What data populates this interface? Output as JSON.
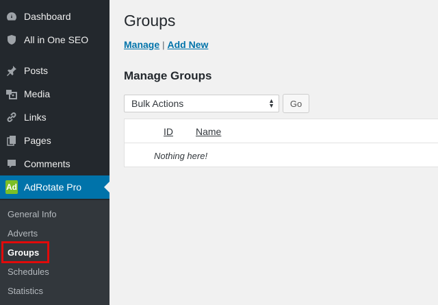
{
  "sidebar": {
    "menu": [
      {
        "label": "Dashboard",
        "icon": "dashboard-icon"
      },
      {
        "label": "All in One SEO",
        "icon": "shield-icon"
      },
      {
        "label": "Posts",
        "icon": "pin-icon"
      },
      {
        "label": "Media",
        "icon": "media-icon"
      },
      {
        "label": "Links",
        "icon": "link-icon"
      },
      {
        "label": "Pages",
        "icon": "pages-icon"
      },
      {
        "label": "Comments",
        "icon": "comment-icon"
      },
      {
        "label": "AdRotate Pro",
        "icon": "adrotate-icon",
        "badge": "Ad"
      }
    ],
    "submenu": [
      {
        "label": "General Info"
      },
      {
        "label": "Adverts"
      },
      {
        "label": "Groups"
      },
      {
        "label": "Schedules"
      },
      {
        "label": "Statistics"
      }
    ]
  },
  "main": {
    "title": "Groups",
    "subnav": {
      "manage": "Manage",
      "separator": "|",
      "add_new": "Add New"
    },
    "section_title": "Manage Groups",
    "bulk_actions": {
      "selected": "Bulk Actions",
      "go_label": "Go"
    },
    "table": {
      "columns": [
        "ID",
        "Name"
      ],
      "empty_message": "Nothing here!"
    }
  },
  "colors": {
    "sidebar_bg": "#23282d",
    "submenu_bg": "#32373c",
    "active_blue": "#0073aa",
    "highlight_red": "#e20a0a",
    "adrotate_green": "#7bbf26"
  }
}
